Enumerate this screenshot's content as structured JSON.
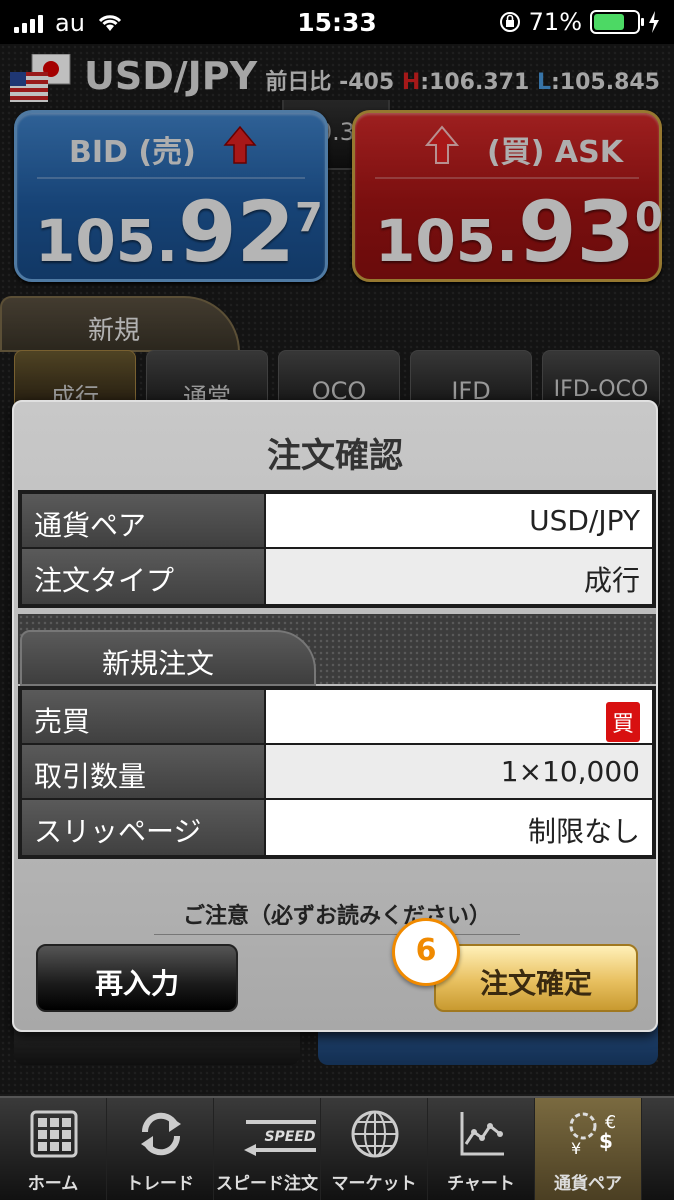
{
  "status": {
    "carrier": "au",
    "time": "15:33",
    "battery": "71%"
  },
  "pair": {
    "name": "USD/JPY",
    "change_label": "前日比",
    "change": "-405",
    "h_label": "H",
    "high": ":106.371",
    "l_label": "L",
    "low": ":105.845"
  },
  "bid": {
    "label": "BID (売)",
    "small": "105.",
    "big": "92",
    "sup": "7"
  },
  "ask": {
    "label": "(買) ASK",
    "small": "105.",
    "big": "93",
    "sup": "0"
  },
  "spread": "0.3",
  "tab_new": "新規",
  "order_types": [
    "成行",
    "通常",
    "OCO",
    "IFD",
    "IFD-OCO"
  ],
  "modal": {
    "title": "注文確認",
    "table1": [
      {
        "label": "通貨ペア",
        "value": "USD/JPY"
      },
      {
        "label": "注文タイプ",
        "value": "成行"
      }
    ],
    "sub_tab": "新規注文",
    "table2": [
      {
        "label": "売買",
        "value": "買"
      },
      {
        "label": "取引数量",
        "value": "1×10,000"
      },
      {
        "label": "スリッページ",
        "value": "制限なし"
      }
    ],
    "notice": "ご注意（必ずお読みください）",
    "reenter": "再入力",
    "confirm": "注文確定"
  },
  "step_badge": "6",
  "tabbar": [
    "ホーム",
    "トレード",
    "スピード注文",
    "マーケット",
    "チャート",
    "通貨ペア"
  ],
  "speed_icon_text": "SPEED",
  "colors": {
    "bid": "#1f5a9e",
    "ask": "#a31414",
    "accent_gold": "#e8c060",
    "step": "#f08a00"
  }
}
